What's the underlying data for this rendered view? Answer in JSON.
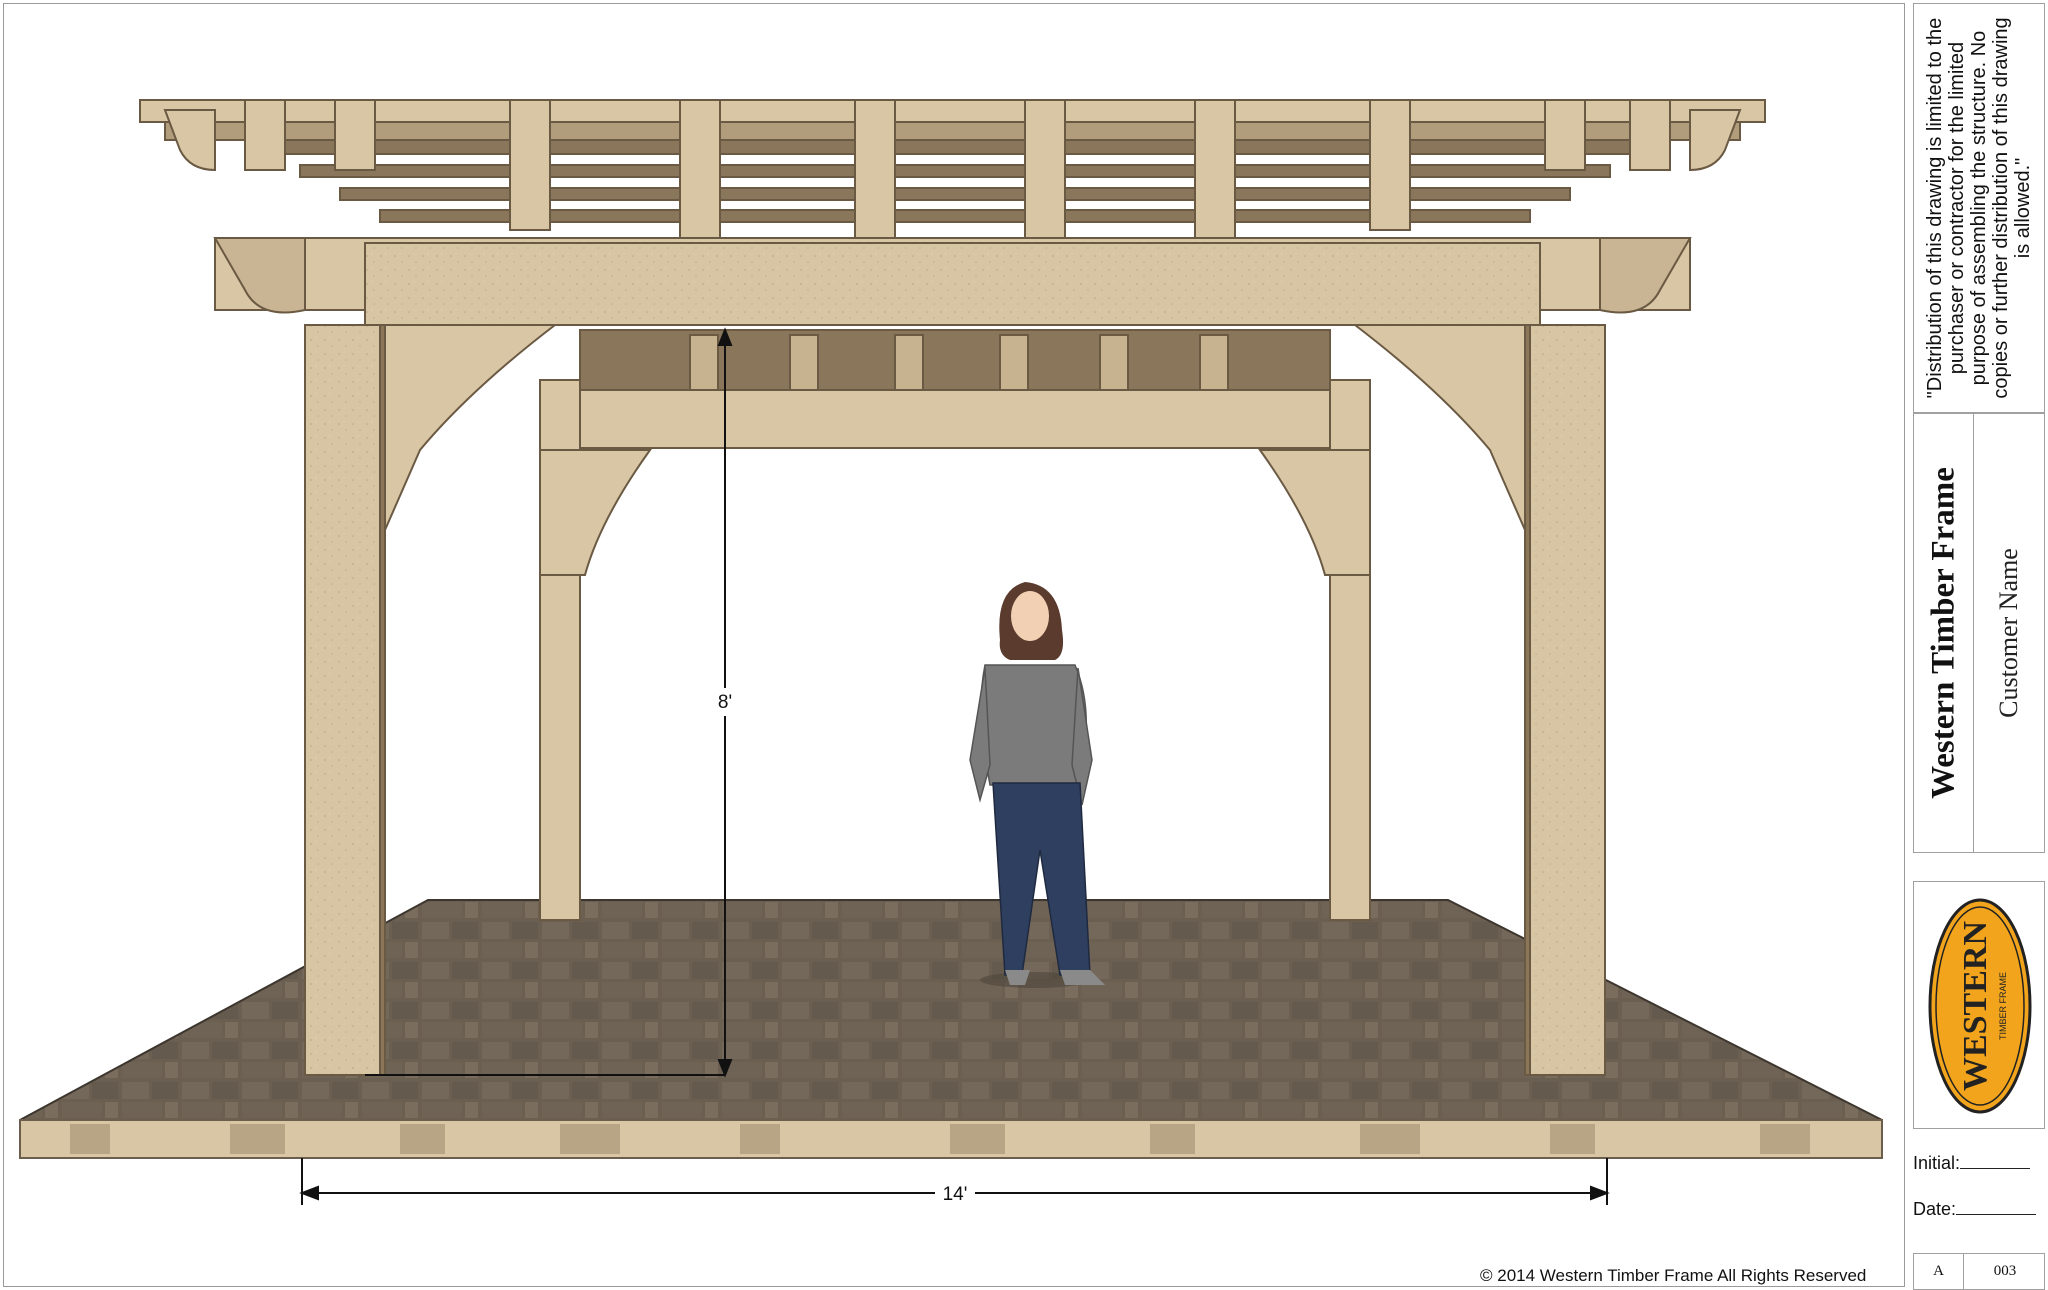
{
  "drawing": {
    "dimension_height": "8'",
    "dimension_width": "14'",
    "copyright": "© 2014 Western Timber Frame All Rights Reserved"
  },
  "title_block": {
    "notice": "\"Distribution of this drawing is limited to the purchaser or contractor for the limited purpose of assembling the structure.  No copies or further distribution of this drawing is allowed.\"",
    "company": "Western Timber Frame",
    "customer": "Customer Name",
    "logo_text": "WESTERN",
    "logo_subtext": "TIMBER FRAME",
    "initial_label": "Initial:",
    "date_label": "Date:",
    "sheet_letter": "A",
    "sheet_number": "003"
  },
  "colors": {
    "timber": "#d9c6a5",
    "timber_shadow": "#8c7658",
    "paving": "#6e6254",
    "logo_orange": "#f2a51c"
  }
}
